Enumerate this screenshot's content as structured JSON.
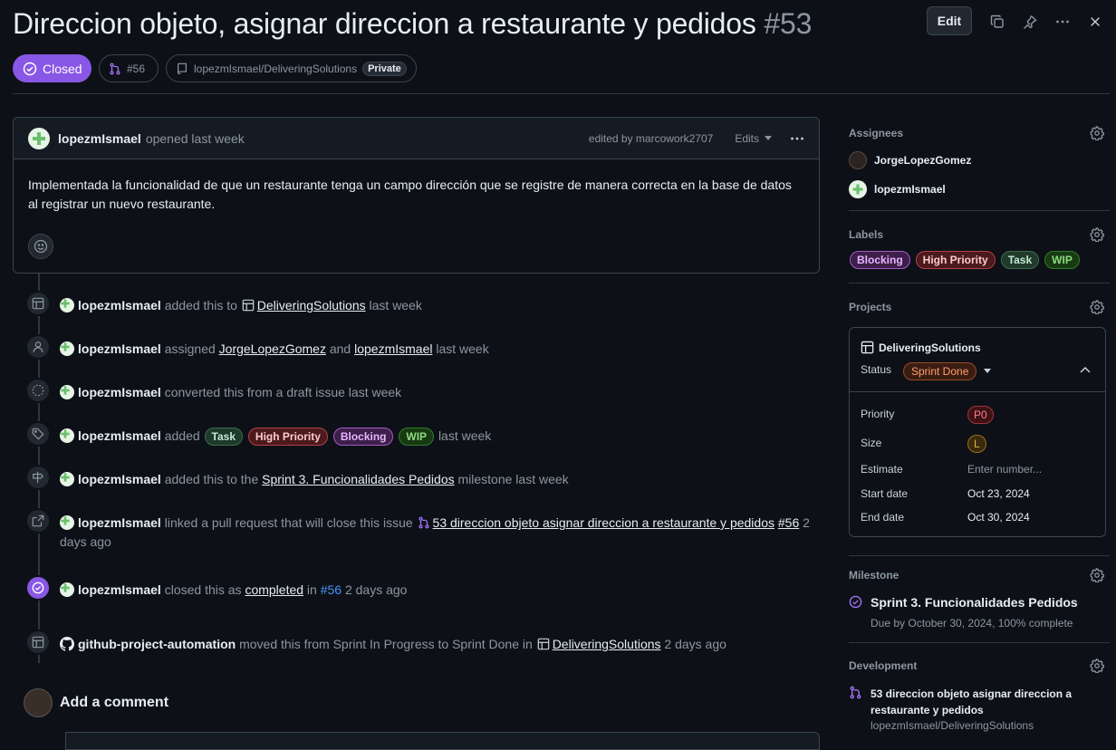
{
  "header": {
    "title": "Direccion objeto, asignar direccion a restaurante y pedidos",
    "number": "#53",
    "edit_label": "Edit",
    "state_label": "Closed",
    "linked_pr": "#56",
    "repo": "lopezmIsmael/DeliveringSolutions",
    "visibility": "Private"
  },
  "comment": {
    "author": "lopezmIsmael",
    "action": "opened last week",
    "edited_by": "edited by marcowork2707",
    "edits_label": "Edits",
    "body": "Implementada la funcionalidad de que un restaurante tenga un campo dirección que se registre de manera correcta en la base de datos al registrar un nuevo restaurante."
  },
  "timeline": {
    "ev1": {
      "actor": "lopezmIsmael",
      "t1": "added this to",
      "project": "DeliveringSolutions",
      "t2": "last week"
    },
    "ev2": {
      "actor": "lopezmIsmael",
      "t1": "assigned",
      "user1": "JorgeLopezGomez",
      "and": "and",
      "user2": "lopezmIsmael",
      "t2": "last week"
    },
    "ev3": {
      "actor": "lopezmIsmael",
      "t1": "converted this from a draft issue last week"
    },
    "ev4": {
      "actor": "lopezmIsmael",
      "t1": "added",
      "labels": [
        "Task",
        "High Priority",
        "Blocking",
        "WIP"
      ],
      "t2": "last week"
    },
    "ev5": {
      "actor": "lopezmIsmael",
      "t1": "added this to the",
      "milestone": "Sprint 3. Funcionalidades Pedidos",
      "t2": "milestone last week"
    },
    "ev6": {
      "actor": "lopezmIsmael",
      "t1": "linked a pull request that will close this issue",
      "pr_title": "53 direccion objeto asignar direccion a restaurante y pedidos",
      "pr_num": "#56",
      "t2": "2 days ago"
    },
    "ev7": {
      "actor": "lopezmIsmael",
      "t1": "closed this as",
      "completed": "completed",
      "in": "in",
      "pr": "#56",
      "t2": "2 days ago"
    },
    "ev8": {
      "actor": "github-project-automation",
      "t1": "moved this from Sprint In Progress to Sprint Done in",
      "project": "DeliveringSolutions",
      "t2": "2 days ago"
    }
  },
  "add_comment": "Add a comment",
  "sidebar": {
    "assignees_title": "Assignees",
    "assignees": [
      "JorgeLopezGomez",
      "lopezmIsmael"
    ],
    "labels_title": "Labels",
    "labels": [
      "Blocking",
      "High Priority",
      "Task",
      "WIP"
    ],
    "projects_title": "Projects",
    "project": {
      "name": "DeliveringSolutions",
      "status_label": "Status",
      "status_value": "Sprint Done",
      "fields": {
        "priority_label": "Priority",
        "priority_value": "P0",
        "size_label": "Size",
        "size_value": "L",
        "estimate_label": "Estimate",
        "estimate_placeholder": "Enter number...",
        "start_label": "Start date",
        "start_value": "Oct 23, 2024",
        "end_label": "End date",
        "end_value": "Oct 30, 2024"
      }
    },
    "milestone_title": "Milestone",
    "milestone_name": "Sprint 3. Funcionalidades Pedidos",
    "milestone_due": "Due by October 30, 2024, 100% complete",
    "development_title": "Development",
    "dev_pr_title": "53 direccion objeto asignar direccion a restaurante y pedidos",
    "dev_pr_repo": "lopezmIsmael/DeliveringSolutions"
  },
  "colors": {
    "accent_purple": "#8957e5",
    "bg": "#0d1117",
    "border": "#3d444d"
  }
}
